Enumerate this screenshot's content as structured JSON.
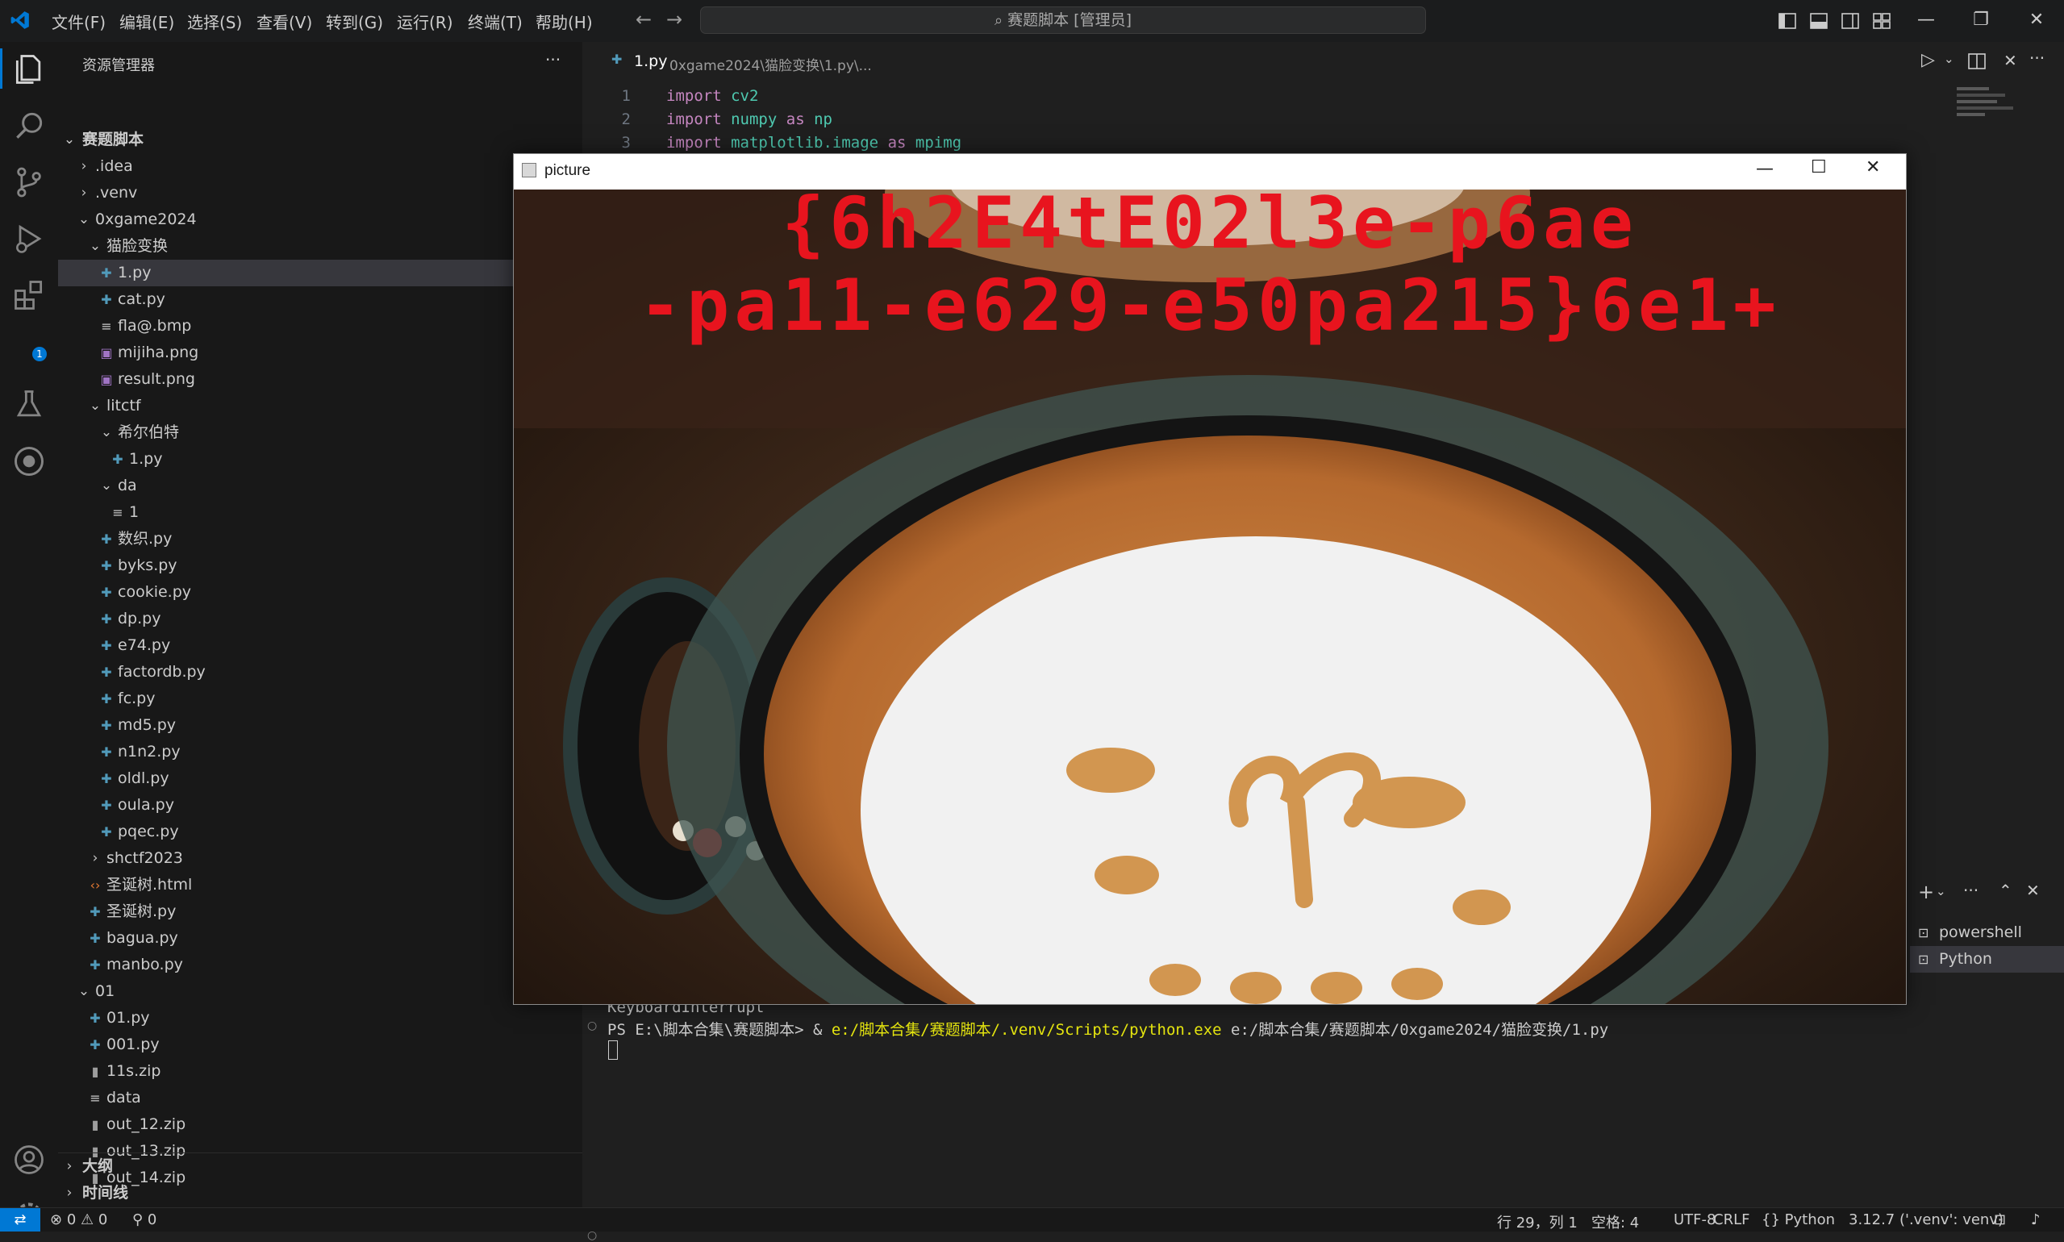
{
  "titlebar": {
    "menu": [
      "文件(F)",
      "编辑(E)",
      "选择(S)",
      "查看(V)",
      "转到(G)",
      "运行(R)",
      "终端(T)",
      "帮助(H)"
    ],
    "search": "赛题脚本 [管理员]"
  },
  "explorer": {
    "title": "资源管理器",
    "more": "···",
    "root": "赛题脚本",
    "items": [
      {
        "label": ".idea",
        "type": "folder-closed"
      },
      {
        "label": ".venv",
        "type": "folder-closed"
      },
      {
        "label": "0xgame2024",
        "type": "folder-open"
      },
      {
        "label": "猫脸变换",
        "type": "folder-open"
      },
      {
        "label": "1.py",
        "type": "py"
      },
      {
        "label": "cat.py",
        "type": "py"
      },
      {
        "label": "fla@.bmp",
        "type": "text"
      },
      {
        "label": "mijiha.png",
        "type": "img"
      },
      {
        "label": "result.png",
        "type": "img"
      },
      {
        "label": "litctf",
        "type": "folder-open"
      },
      {
        "label": "希尔伯特",
        "type": "folder-open"
      },
      {
        "label": "1.py",
        "type": "py"
      },
      {
        "label": "da",
        "type": "folder-open"
      },
      {
        "label": "1",
        "type": "text"
      },
      {
        "label": "数织.py",
        "type": "py"
      },
      {
        "label": "byks.py",
        "type": "py"
      },
      {
        "label": "cookie.py",
        "type": "py"
      },
      {
        "label": "dp.py",
        "type": "py"
      },
      {
        "label": "e74.py",
        "type": "py"
      },
      {
        "label": "factordb.py",
        "type": "py"
      },
      {
        "label": "fc.py",
        "type": "py"
      },
      {
        "label": "md5.py",
        "type": "py"
      },
      {
        "label": "n1n2.py",
        "type": "py"
      },
      {
        "label": "oldl.py",
        "type": "py"
      },
      {
        "label": "oula.py",
        "type": "py"
      },
      {
        "label": "pqec.py",
        "type": "py"
      },
      {
        "label": "shctf2023",
        "type": "folder-closed"
      },
      {
        "label": "圣诞树.html",
        "type": "html"
      },
      {
        "label": "圣诞树.py",
        "type": "py"
      },
      {
        "label": "bagua.py",
        "type": "py"
      },
      {
        "label": "manbo.py",
        "type": "py"
      },
      {
        "label": "01",
        "type": "folder-open"
      },
      {
        "label": "01.py",
        "type": "py"
      },
      {
        "label": "001.py",
        "type": "py"
      },
      {
        "label": "11s.zip",
        "type": "zip"
      },
      {
        "label": "data",
        "type": "text"
      },
      {
        "label": "out_12.zip",
        "type": "zip"
      },
      {
        "label": "out_13.zip",
        "type": "zip"
      },
      {
        "label": "out_14.zip",
        "type": "zip"
      }
    ],
    "outline": "大纲",
    "timeline": "时间线"
  },
  "editor": {
    "tab_name": "1.py",
    "tab_path": "0xgame2024\\猫脸变换\\1.py\\...",
    "lines": [
      {
        "num": "1",
        "kw": "import",
        "rest": "cv2"
      },
      {
        "num": "2",
        "kw": "import",
        "rest": "numpy",
        "kw2": "as",
        "rest2": "np"
      },
      {
        "num": "3",
        "kw": "import",
        "rest": "matplotlib.image",
        "kw2": "as",
        "rest2": "mpimg"
      }
    ]
  },
  "picture_window": {
    "title": "picture",
    "flag_line1": "{6h2E4tE02l3e-p6ae",
    "flag_line2": "-pa11-e629-e50pa215}6e1+"
  },
  "terminal": {
    "line1": "KeyboardInterrupt",
    "prompt": "PS E:\\脚本合集\\赛题脚本> & ",
    "exe": "e:/脚本合集/赛题脚本/.venv/Scripts/python.exe",
    "arg": " e:/脚本合集/赛题脚本/0xgame2024/猫脸变换/1.py",
    "tabs": [
      "powershell",
      "Python"
    ]
  },
  "activity_badge": "1",
  "statusbar": {
    "errors": "0",
    "warnings": "0",
    "ports": "0",
    "position": "行 29，列 1",
    "spaces": "空格: 4",
    "encoding": "UTF-8",
    "eol": "CRLF",
    "language": "Python",
    "interpreter": "3.12.7 ('.venv': venv)"
  },
  "colors": {
    "accent": "#0078d4",
    "python_icon": "#519aba",
    "flag_red": "#e8141e",
    "terminal_path": "#e5e510"
  }
}
